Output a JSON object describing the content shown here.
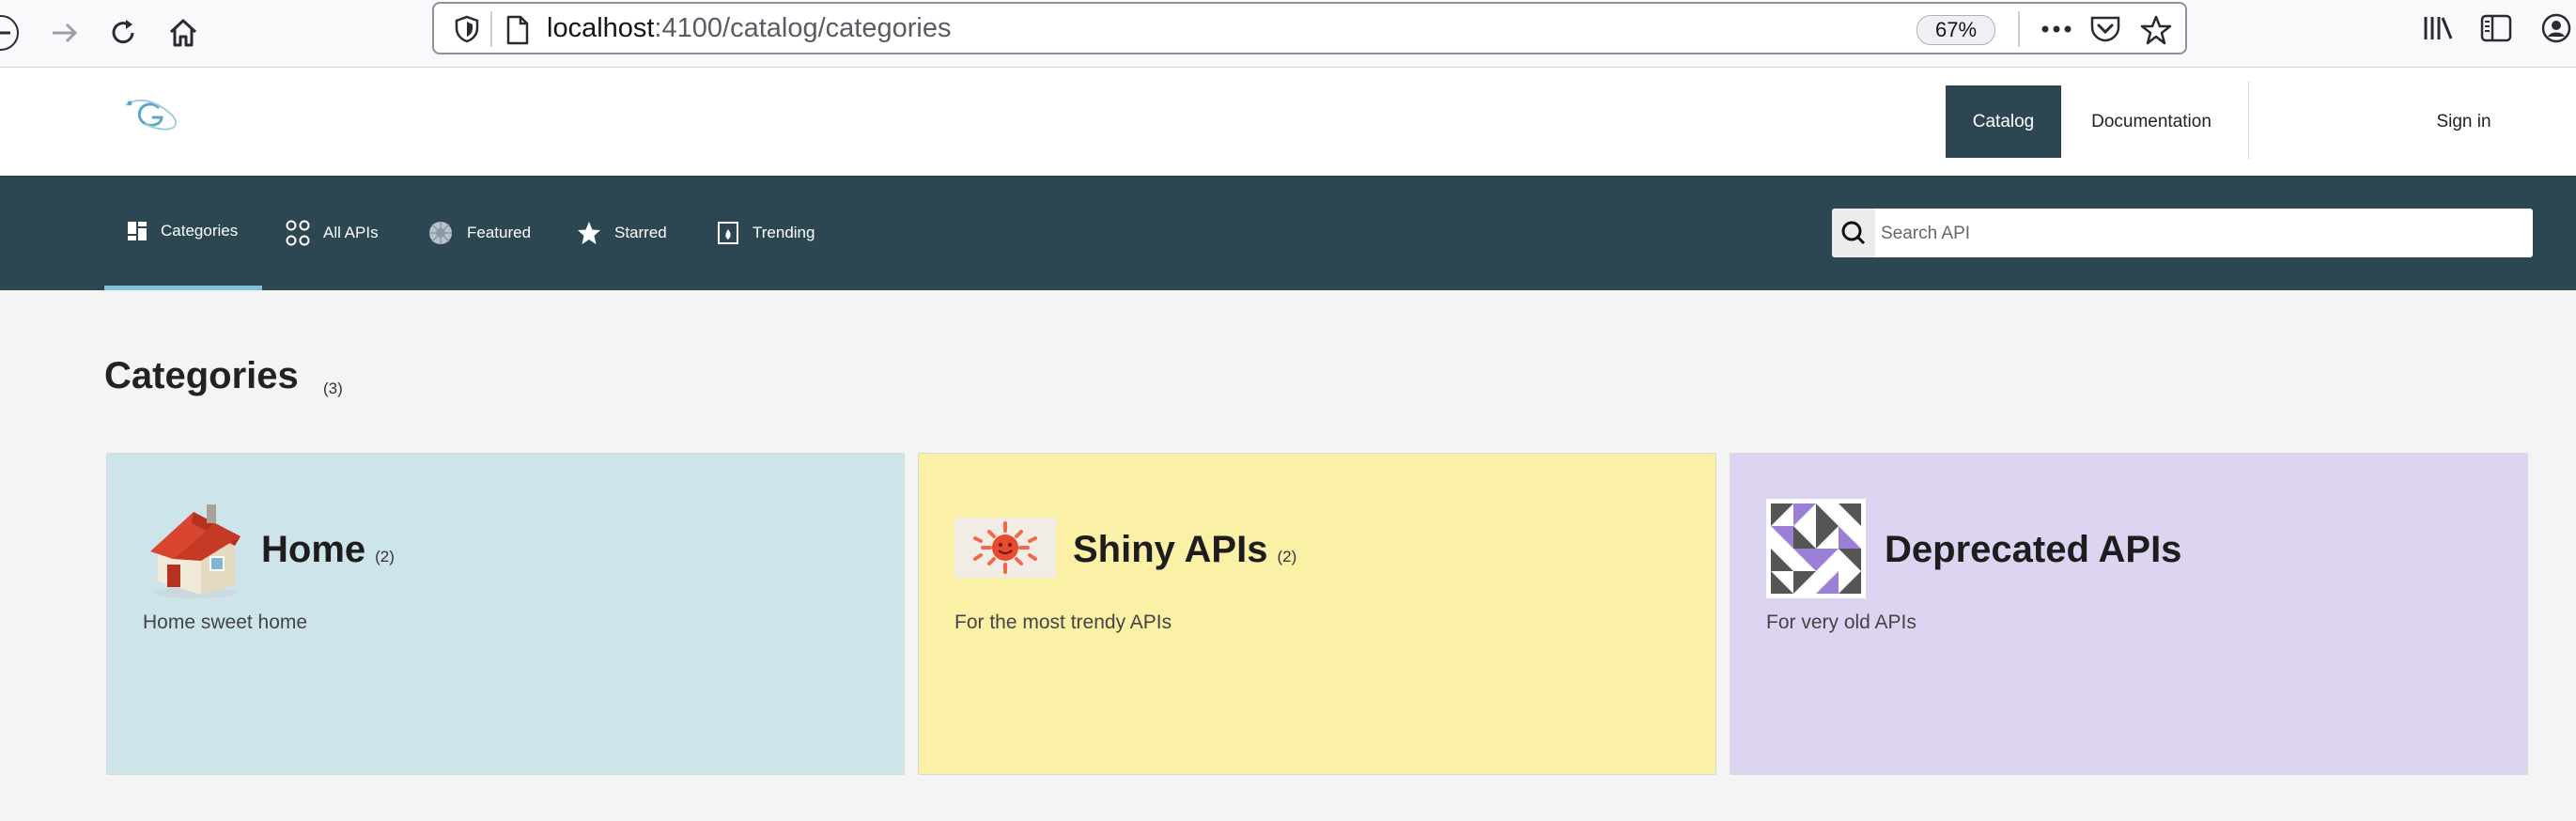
{
  "browser": {
    "url_host": "localhost",
    "url_path": ":4100/catalog/categories",
    "zoom": "67%"
  },
  "header": {
    "nav": {
      "catalog": "Catalog",
      "documentation": "Documentation",
      "sign_in": "Sign in"
    }
  },
  "subnav": {
    "items": [
      {
        "label": "Categories",
        "icon": "categories-icon"
      },
      {
        "label": "All APIs",
        "icon": "all-apis-icon"
      },
      {
        "label": "Featured",
        "icon": "featured-icon"
      },
      {
        "label": "Starred",
        "icon": "star-icon"
      },
      {
        "label": "Trending",
        "icon": "trending-icon"
      }
    ],
    "search_placeholder": "Search API"
  },
  "main": {
    "title": "Categories",
    "count": "(3)",
    "cards": [
      {
        "title": "Home",
        "count": "(2)",
        "description": "Home sweet home",
        "bg": "#cde4ea",
        "image": "house-icon"
      },
      {
        "title": "Shiny APIs",
        "count": "(2)",
        "description": "For the most trendy APIs",
        "bg": "#faf0a6",
        "image": "sun-icon"
      },
      {
        "title": "Deprecated APIs",
        "count": "",
        "description": "For very old APIs",
        "bg": "#dcd4f0",
        "image": "quilt-pattern-icon"
      }
    ]
  },
  "colors": {
    "primary": "#2c4652",
    "active_underline": "#7fc3db"
  }
}
